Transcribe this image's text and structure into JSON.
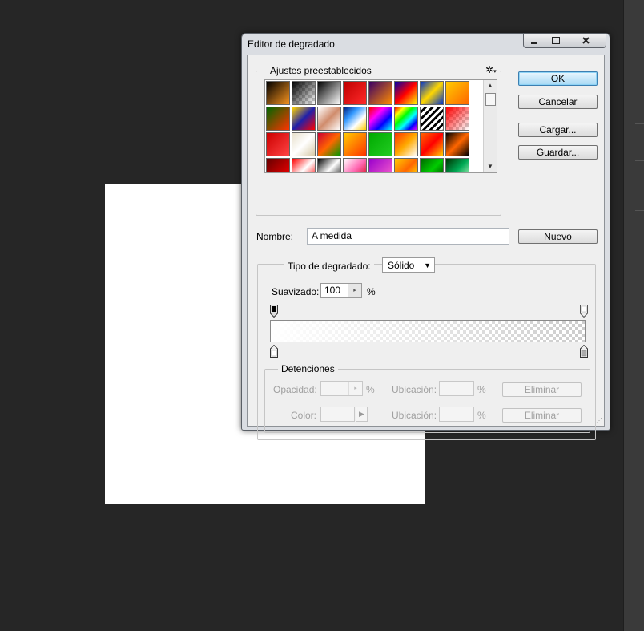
{
  "dialog": {
    "title": "Editor de degradado",
    "minimize_icon": "minimize-icon",
    "maximize_icon": "maximize-icon",
    "close_icon": "close-icon"
  },
  "presets": {
    "legend": "Ajustes preestablecidos",
    "menu_icon": "gear-icon",
    "menu_glyph": "✲",
    "swatches": [
      "linear-gradient(135deg,#000,#f7931e)",
      "linear-gradient(135deg,#000 0%,rgba(0,0,0,0) 100%)",
      "linear-gradient(135deg,#000,#fff)",
      "linear-gradient(135deg,#c00000,#ff2a2a)",
      "linear-gradient(135deg,#3b0066,#ff8c00)",
      "linear-gradient(135deg,#0000aa,#ff0000,#ffff00)",
      "linear-gradient(135deg,#0033cc,#ffd700,#0033cc)",
      "linear-gradient(135deg,#ffcc00,#ff6600)",
      "linear-gradient(135deg,#006600,#ff3300)",
      "linear-gradient(135deg,#ffd400,#2020aa,#ff0000)",
      "linear-gradient(135deg,#ffffff,#d08c6c,#fff)",
      "linear-gradient(135deg,#002080,#3399ff,#fff,#ffcc00)",
      "linear-gradient(135deg,#ff0000,#ff00ff,#0000ff,#00ffff)",
      "linear-gradient(135deg,#ff0000,#ffff00,#00ff00,#00ffff,#0000ff,#ff00ff)",
      "repeating-linear-gradient(135deg,#fff 0 3px,#000 3px 6px)",
      "linear-gradient(135deg,rgba(255,0,0,1),rgba(255,0,0,0))",
      "linear-gradient(135deg,#cc0000,#ff4444)",
      "linear-gradient(135deg,#e8e0cc,#fff,#d6c9a6)",
      "linear-gradient(135deg,#cc0033,#ff6600,#009900)",
      "linear-gradient(135deg,#ffcc00,#ff3300)",
      "linear-gradient(135deg,#00aa00,#22cc22)",
      "linear-gradient(135deg,#ff3300,#ffaa00,#fff)",
      "linear-gradient(135deg,#ff6600,#ff0000,#ffcc00)",
      "linear-gradient(135deg,#000,#ff6600,#000)",
      "linear-gradient(135deg,#660000,#ff0000)",
      "linear-gradient(135deg,#ff0000,#fff,#ff0000)",
      "linear-gradient(135deg,#000,#fff,#000)",
      "linear-gradient(135deg,#ffffff,#ff69b4,#cc0000)",
      "linear-gradient(135deg,#9900cc,#ff66cc)",
      "linear-gradient(135deg,#ffcc00,#ff6600,#ffff00)",
      "linear-gradient(135deg,#006600,#00cc00,#003300)",
      "linear-gradient(135deg,#003300,#00aa55,#ccffcc)"
    ],
    "scroll_up_glyph": "▲",
    "scroll_down_glyph": "▼"
  },
  "buttons": {
    "ok": "OK",
    "cancel": "Cancelar",
    "load": "Cargar...",
    "save": "Guardar...",
    "new": "Nuevo"
  },
  "name": {
    "label": "Nombre:",
    "value": "A medida"
  },
  "gradient": {
    "type_label": "Tipo de degradado:",
    "type_value": "Sólido",
    "type_arrow": "▼",
    "smoothness_label": "Suavizado:",
    "smoothness_value": "100",
    "smoothness_unit": "%",
    "spin_glyph": "▸",
    "start_color": "#ffffff",
    "end_color": "transparent"
  },
  "stops": {
    "legend": "Detenciones",
    "opacity_label": "Opacidad:",
    "opacity_unit": "%",
    "location_label_1": "Ubicación:",
    "location_unit_1": "%",
    "delete_1": "Eliminar",
    "color_label": "Color:",
    "color_arrow": "▶",
    "location_label_2": "Ubicación:",
    "location_unit_2": "%",
    "delete_2": "Eliminar"
  }
}
